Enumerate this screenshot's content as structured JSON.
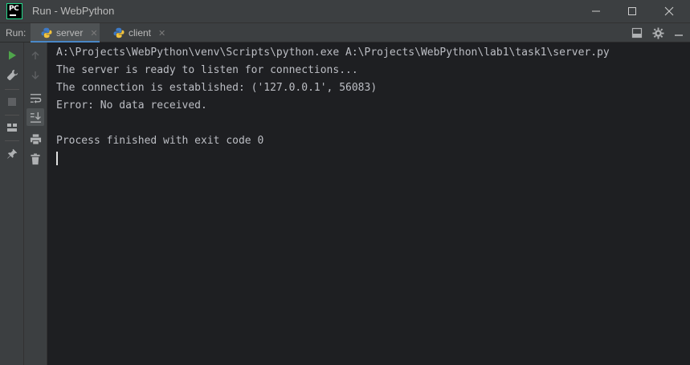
{
  "window": {
    "app_logo_text": "PC",
    "title": "Run - WebPython"
  },
  "run_panel": {
    "label": "Run:",
    "tabs": [
      {
        "label": "server",
        "active": true
      },
      {
        "label": "client",
        "active": false
      }
    ]
  },
  "console": {
    "lines": [
      "A:\\Projects\\WebPython\\venv\\Scripts\\python.exe A:\\Projects\\WebPython\\lab1\\task1\\server.py",
      "The server is ready to listen for connections...",
      "The connection is established: ('127.0.0.1', 56083)",
      "Error: No data received.",
      "",
      "Process finished with exit code 0"
    ]
  },
  "colors": {
    "run_green": "#4fa54b",
    "active_tab_underline": "#4a88c7",
    "console_bg": "#1e1f22",
    "console_text": "#bcbec4"
  },
  "icons": {
    "rerun": "play-icon",
    "wrench": "wrench-icon",
    "stop": "stop-icon",
    "layout": "layout-icon",
    "pin": "pin-icon",
    "up": "arrow-up-icon",
    "down": "arrow-down-icon",
    "soft_wrap": "soft-wrap-icon",
    "scroll_end": "scroll-to-end-icon",
    "print": "print-icon",
    "trash": "trash-icon"
  }
}
